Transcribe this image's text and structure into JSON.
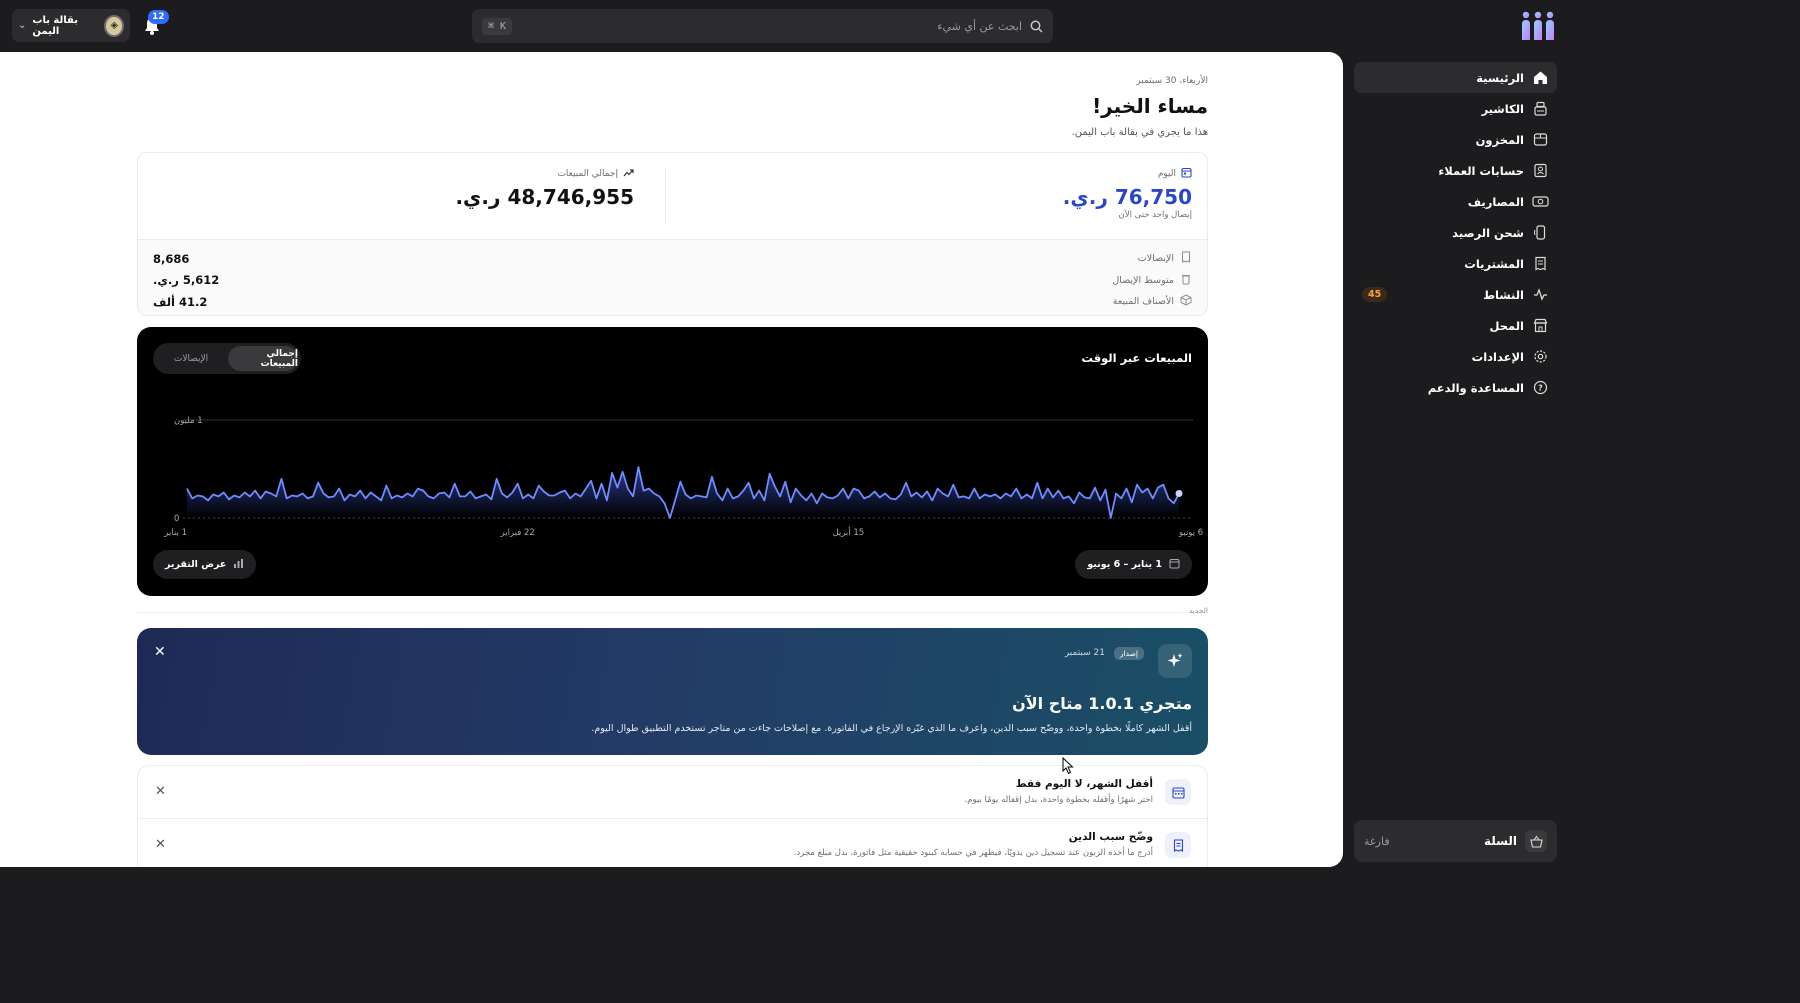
{
  "topbar": {
    "store_name": "بقالة باب اليمن",
    "notifications_count": "12",
    "search_placeholder": "ابحث عن أي شيء",
    "search_shortcut": "⌘ K"
  },
  "sidebar": {
    "items": [
      {
        "label": "الرئيسية",
        "icon": "home-icon",
        "active": true
      },
      {
        "label": "الكاشير",
        "icon": "cash-register-icon"
      },
      {
        "label": "المخزون",
        "icon": "box-icon"
      },
      {
        "label": "حسابات العملاء",
        "icon": "contacts-icon"
      },
      {
        "label": "المصاريف",
        "icon": "money-icon"
      },
      {
        "label": "شحن الرصيد",
        "icon": "phone-icon"
      },
      {
        "label": "المشتريات",
        "icon": "receipt-icon"
      },
      {
        "label": "النشاط",
        "icon": "activity-icon",
        "badge": "45"
      },
      {
        "label": "المحل",
        "icon": "store-icon"
      },
      {
        "label": "الإعدادات",
        "icon": "gear-icon"
      },
      {
        "label": "المساعدة والدعم",
        "icon": "help-icon"
      }
    ],
    "cart_label": "السلة",
    "cart_status": "فارغة"
  },
  "header": {
    "date": "الأربعاء، 30 سبتمبر",
    "greeting": "مساء الخير!",
    "subtitle": "هذا ما يجري في بقالة باب اليمن."
  },
  "stats": {
    "today_label": "اليوم",
    "today_value": "76,750 ر.ي.",
    "today_note": "إيصال واحد حتى الآن",
    "total_label": "إجمالي المبيعات",
    "total_value": "48,746,955 ر.ي.",
    "rows": [
      {
        "label": "الإيصالات",
        "value": "8,686",
        "icon": "receipt-icon"
      },
      {
        "label": "متوسط الإيصال",
        "value": "5,612 ر.ي.",
        "icon": "trash-icon"
      },
      {
        "label": "الأصناف المبيعة",
        "value": "41.2 ألف",
        "icon": "cube-icon"
      }
    ]
  },
  "chart": {
    "title": "المبيعات عبر الوقت",
    "tabs": [
      "إجمالي المبيعات",
      "الإيصالات"
    ],
    "active_tab": 0,
    "range_label": "1 يناير – 6 يونيو",
    "report_label": "عرض التقرير"
  },
  "chart_data": {
    "type": "area",
    "title": "المبيعات عبر الوقت",
    "y_ticks": [
      "0",
      "1 مليون"
    ],
    "ylim": [
      0,
      1000000
    ],
    "x_ticks": [
      "1 يناير",
      "22 فبراير",
      "15 أبريل",
      "6 يونيو"
    ],
    "series": [
      {
        "name": "إجمالي المبيعات",
        "values": [
          300000,
          200000,
          230000,
          220000,
          180000,
          240000,
          220000,
          260000,
          190000,
          230000,
          210000,
          260000,
          220000,
          280000,
          200000,
          270000,
          250000,
          220000,
          400000,
          200000,
          230000,
          220000,
          250000,
          200000,
          220000,
          360000,
          250000,
          210000,
          220000,
          300000,
          180000,
          240000,
          220000,
          280000,
          200000,
          260000,
          220000,
          180000,
          330000,
          200000,
          230000,
          210000,
          250000,
          220000,
          300000,
          280000,
          220000,
          200000,
          250000,
          260000,
          210000,
          350000,
          220000,
          220000,
          270000,
          200000,
          220000,
          240000,
          190000,
          400000,
          250000,
          210000,
          260000,
          350000,
          200000,
          240000,
          200000,
          330000,
          270000,
          230000,
          230000,
          260000,
          280000,
          200000,
          250000,
          220000,
          300000,
          380000,
          200000,
          350000,
          180000,
          460000,
          310000,
          470000,
          300000,
          220000,
          520000,
          280000,
          300000,
          250000,
          220000,
          150000,
          0,
          180000,
          370000,
          240000,
          200000,
          230000,
          220000,
          210000,
          420000,
          250000,
          180000,
          300000,
          200000,
          220000,
          280000,
          360000,
          200000,
          280000,
          180000,
          450000,
          320000,
          220000,
          370000,
          160000,
          300000,
          230000,
          180000,
          250000,
          150000,
          250000,
          210000,
          200000,
          230000,
          300000,
          200000,
          300000,
          280000,
          200000,
          220000,
          270000,
          210000,
          250000,
          200000,
          190000,
          240000,
          360000,
          220000,
          260000,
          210000,
          270000,
          180000,
          300000,
          250000,
          220000,
          340000,
          210000,
          220000,
          200000,
          300000,
          200000,
          240000,
          220000,
          240000,
          200000,
          250000,
          220000,
          300000,
          200000,
          240000,
          200000,
          360000,
          200000,
          300000,
          210000,
          280000,
          200000,
          220000,
          150000,
          260000,
          210000,
          200000,
          310000,
          180000,
          290000,
          0,
          250000,
          200000,
          300000,
          160000,
          340000,
          260000,
          300000,
          200000,
          310000,
          340000,
          200000,
          150000,
          250000
        ]
      }
    ]
  },
  "news": {
    "section_label": "الجديد",
    "release_tag": "إصدار",
    "release_date": "21 سبتمبر",
    "release_title": "متجري 1.0.1 متاح الآن",
    "release_desc": "أقفل الشهر كاملًا بخطوة واحدة، ووضّح سبب الدين، واعرف ما الذي غيّره الإرجاع في الفاتورة. مع إصلاحات جاءت من متاجر تستخدم التطبيق طوال اليوم.",
    "tips": [
      {
        "title": "أقفل الشهر، لا اليوم فقط",
        "desc": "اختر شهرًا وأقفله بخطوة واحدة، بدل إقفاله يومًا بيوم."
      },
      {
        "title": "وضّح سبب الدين",
        "desc": "أدرج ما أخذه الزبون عند تسجيل دين يدويًا، فيظهر في حسابه كبنود حقيقية مثل فاتورة، بدل مبلغ مجرد."
      }
    ]
  },
  "colors": {
    "accent": "#2a46c9",
    "line": "#6e8cff",
    "badge": "#ff9f3a"
  }
}
